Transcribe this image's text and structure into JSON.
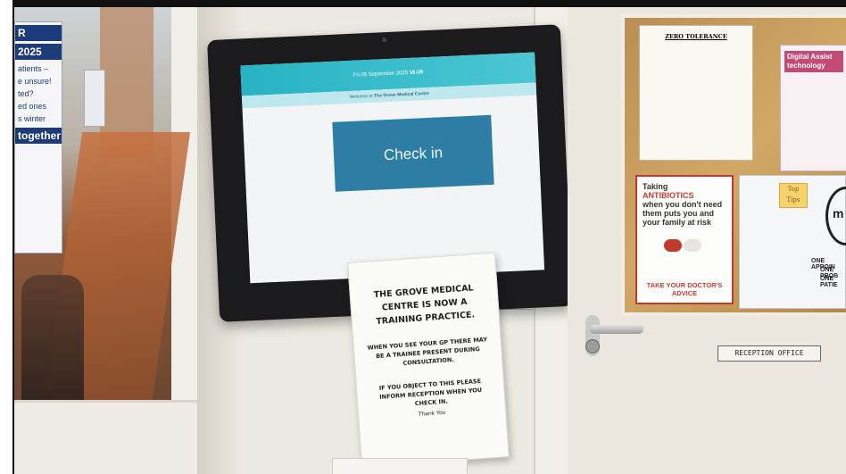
{
  "kiosk": {
    "date": "Fri 05 September 2025",
    "time": "16:29",
    "welcome_prefix": "Welcome to",
    "practice_name": "The Grove Medical Centre",
    "checkin_label": "Check in",
    "accent_color": "#2e7da4",
    "header_color": "#27b3c3"
  },
  "sign": {
    "title": "THE GROVE MEDICAL CENTRE IS NOW A TRAINING PRACTICE.",
    "para1": "WHEN YOU SEE YOUR GP THERE MAY BE A TRAINEE PRESENT DURING CONSULTATION.",
    "para2": "IF YOU OBJECT TO THIS PLEASE INFORM RECEPTION WHEN YOU CHECK IN.",
    "thanks": "Thank You"
  },
  "left_poster": {
    "line1": "R",
    "line2": "2025",
    "line3": "atients –",
    "line4": "e unsure!",
    "line5": "ted?",
    "line6": "ed ones",
    "line7": "s winter",
    "line8": "together"
  },
  "zero_tolerance": {
    "heading": "ZERO TOLERANCE"
  },
  "digital_notice": {
    "heading": "Digital Assist technology"
  },
  "antibiotics_poster": {
    "line1": "Taking",
    "line2": "ANTIBIOTICS",
    "line3": "when you don't need them puts you and your family at risk",
    "footer": "TAKE YOUR DOCTOR'S ADVICE"
  },
  "tips_poster": {
    "badge": "Top Tips",
    "clock_text": "m",
    "line1": "ONE APPOIN",
    "line2": "ONE PROB",
    "line3": "ONE PATIE"
  },
  "door": {
    "plate": "RECEPTION OFFICE"
  }
}
